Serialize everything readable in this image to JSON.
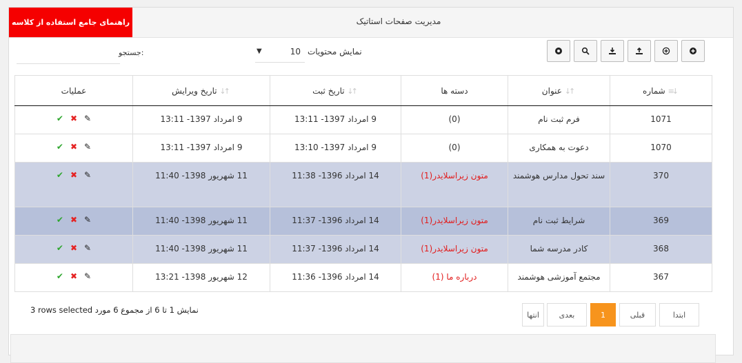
{
  "header": {
    "title": "مدیریت صفحات استاتیک",
    "guide_button": "راهنمای جامع استفاده از کلاسه"
  },
  "controls": {
    "search_label": "جستجو:",
    "search_value": "",
    "length_label": "نمایش محتویات",
    "length_value": "10",
    "toolbar_icons": [
      "plus-circle-icon",
      "plus-outline-icon",
      "export-icon",
      "import-icon",
      "search-icon",
      "settings-icon"
    ]
  },
  "table": {
    "columns": [
      "شماره",
      "عنوان",
      "دسته ها",
      "تاریخ ثبت",
      "تاریخ ویرایش",
      "عملیات"
    ],
    "rows": [
      {
        "id": "1071",
        "title": "فرم ثبت نام",
        "category": "(0)",
        "created": "9 امرداد 1397- 13:11",
        "edited": "9 امرداد 1397- 13:11",
        "state": "normal"
      },
      {
        "id": "1070",
        "title": "دعوت به همکاری",
        "category": "(0)",
        "created": "9 امرداد 1397- 13:10",
        "edited": "9 امرداد 1397- 13:11",
        "state": "normal"
      },
      {
        "id": "370",
        "title": "سند تحول مدارس هوشمند",
        "category": "متون زیراسلایدر(1)",
        "created": "14 امرداد 1396- 11:38",
        "edited": "11 شهریور 1398- 11:40",
        "state": "selected"
      },
      {
        "id": "369",
        "title": "شرایط ثبت نام",
        "category": "متون زیراسلایدر(1)",
        "created": "14 امرداد 1396- 11:37",
        "edited": "11 شهریور 1398- 11:40",
        "state": "selected-hover"
      },
      {
        "id": "368",
        "title": "کادر مدرسه شما",
        "category": "متون زیراسلایدر(1)",
        "created": "14 امرداد 1396- 11:37",
        "edited": "11 شهریور 1398- 11:40",
        "state": "selected"
      },
      {
        "id": "367",
        "title": "مجتمع آموزشی هوشمند",
        "category": "درباره ما (1)",
        "created": "14 امرداد 1396- 11:36",
        "edited": "12 شهریور 1398- 13:21",
        "state": "normal"
      }
    ]
  },
  "footer": {
    "info": "نمایش 1 تا 6 از مجموع 6 مورد",
    "selected": "3 rows selected",
    "pagination": {
      "first": "ابتدا",
      "prev": "قبلی",
      "current": "1",
      "next": "بعدی",
      "last": "انتها"
    }
  },
  "colors": {
    "accent_red": "#f50000",
    "pager_active": "#f7941d",
    "selected_row": "#ccd2e4",
    "hover_row": "#b6c0da",
    "category_red": "#e21c1c"
  }
}
